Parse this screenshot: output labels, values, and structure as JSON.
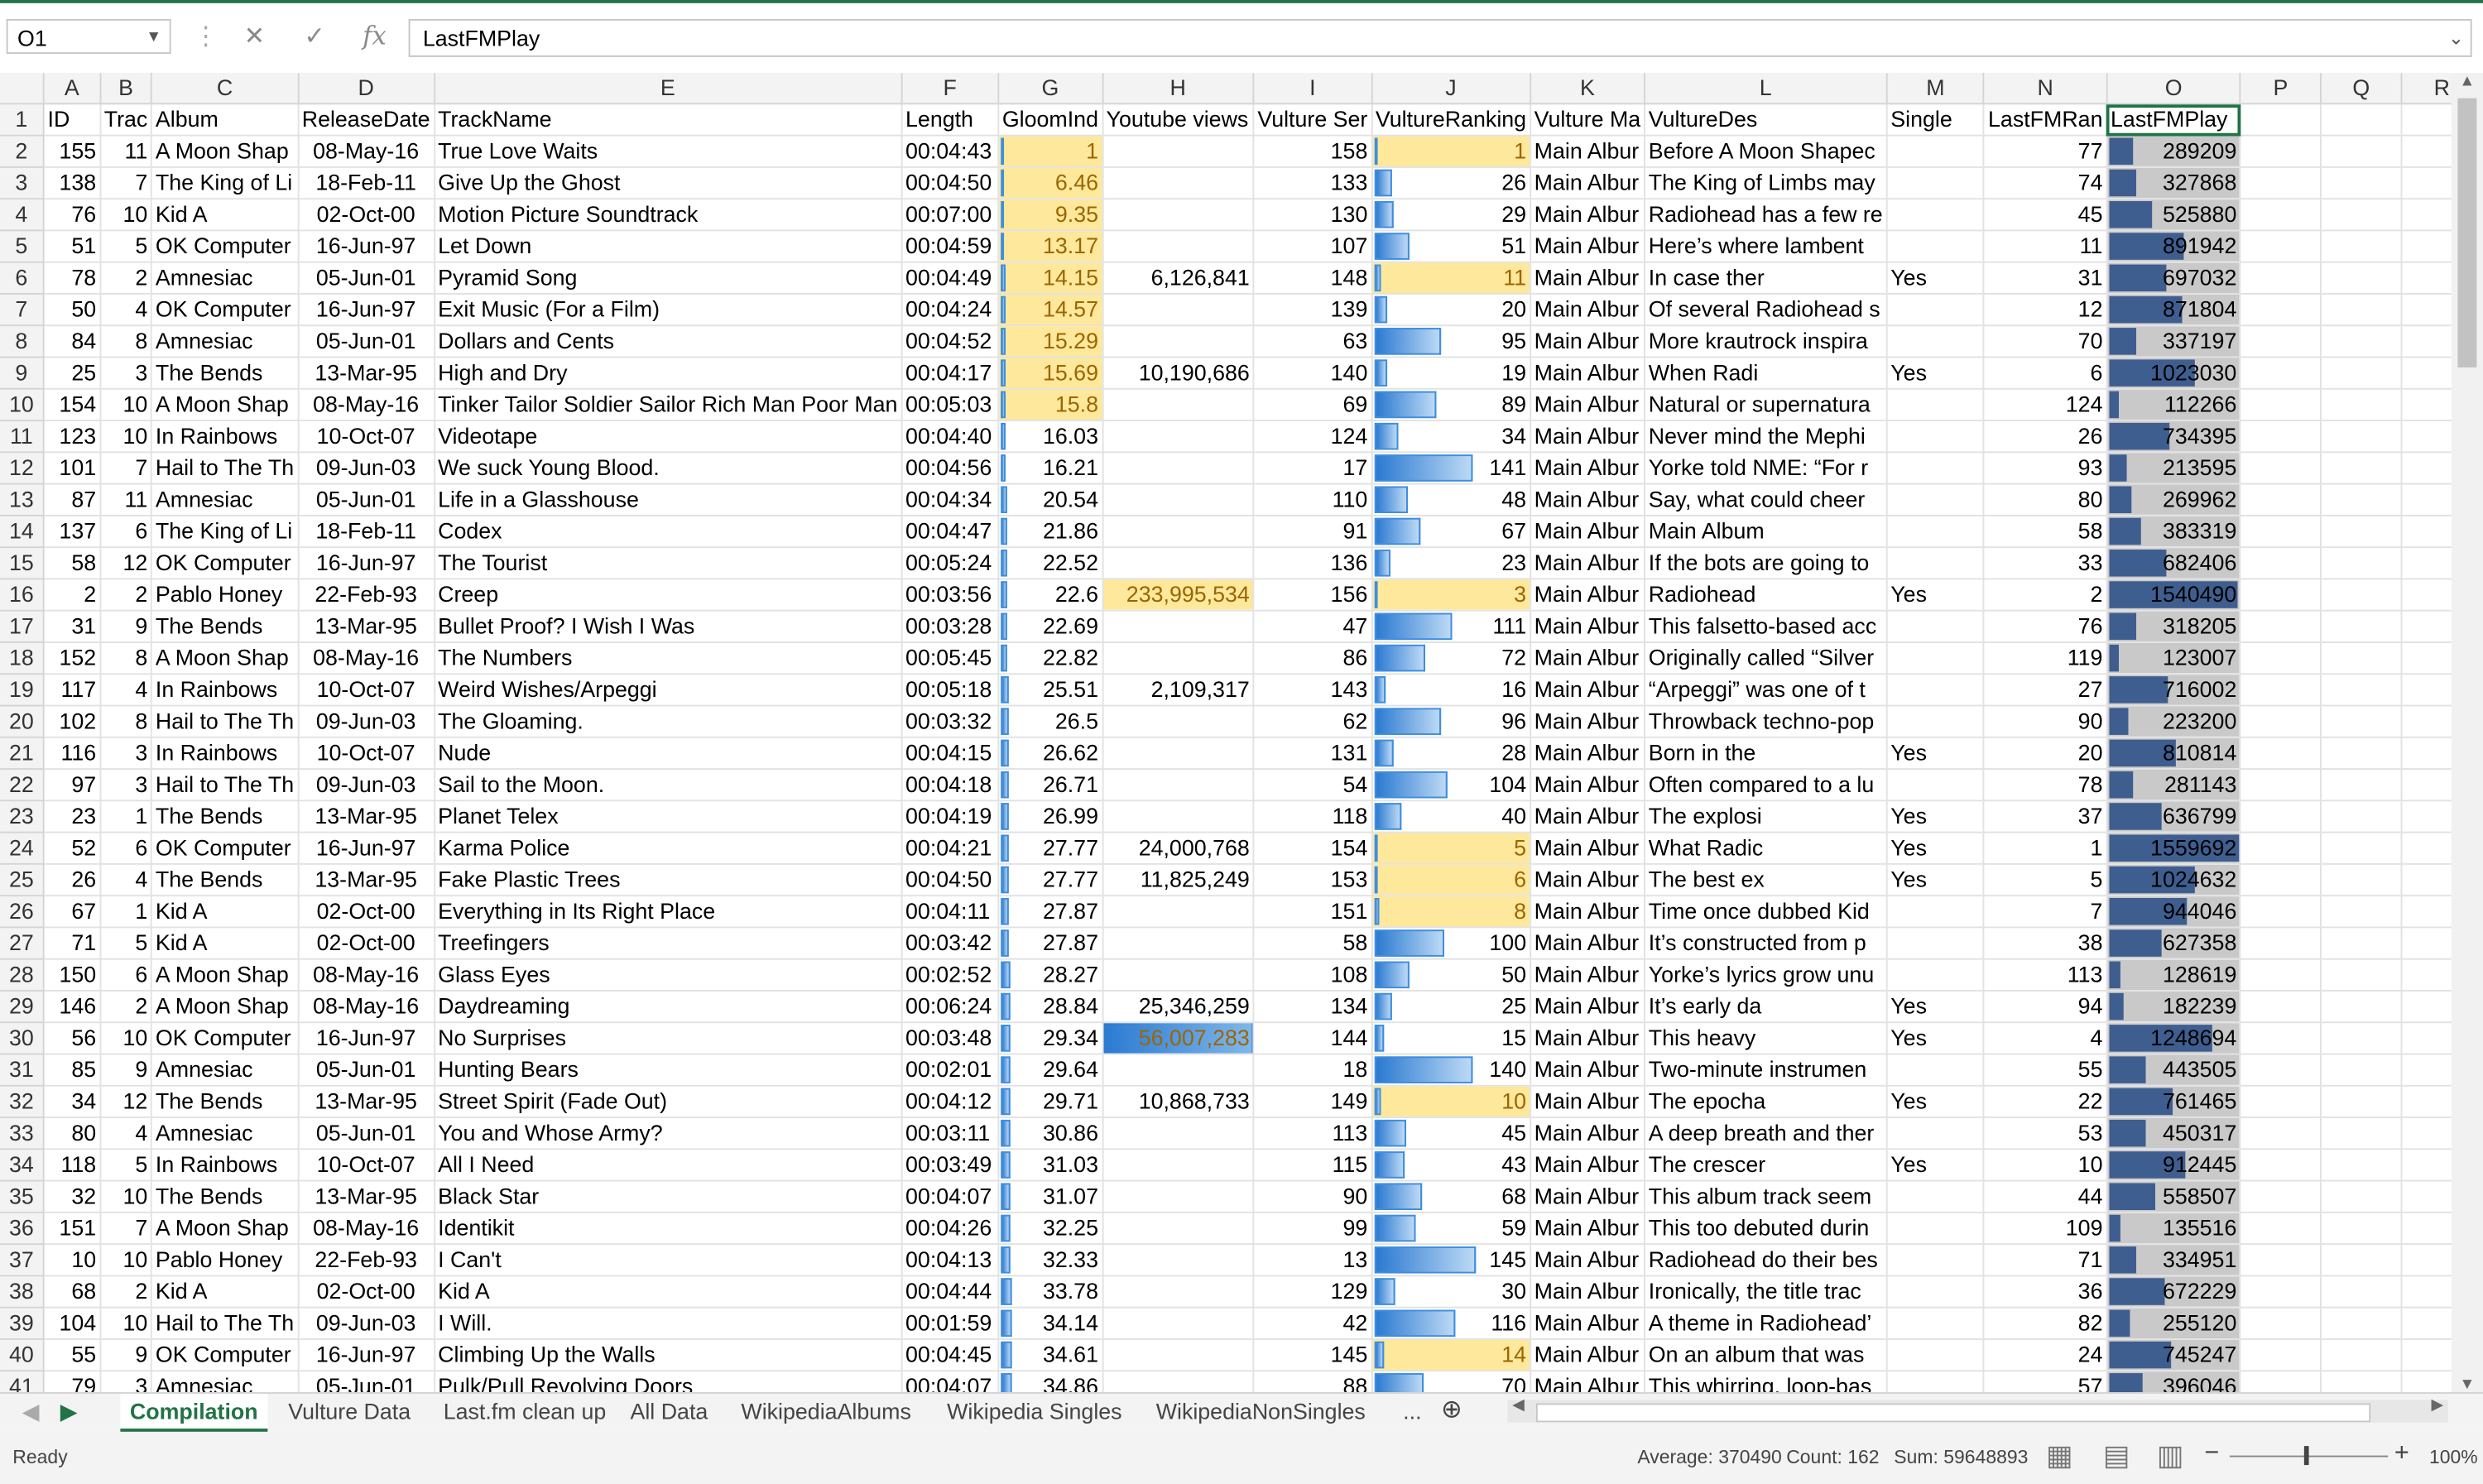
{
  "formula_bar": {
    "name_box": "O1",
    "cancel_icon": "✕",
    "enter_icon": "✓",
    "fx_label": "fx",
    "content": "LastFMPlay"
  },
  "columns": [
    "A",
    "B",
    "C",
    "D",
    "E",
    "F",
    "G",
    "H",
    "I",
    "J",
    "K",
    "L",
    "M",
    "N",
    "O",
    "P",
    "Q",
    "R"
  ],
  "selected_column": "O",
  "header_row": [
    "ID",
    "Trac",
    "Album",
    "ReleaseDate",
    "TrackName",
    "Length",
    "GloomInd",
    "Youtube views",
    "Vulture Ser",
    "VultureRanking",
    "Vulture Ma",
    "VultureDes",
    "Single",
    "LastFMRan",
    "LastFMPlay"
  ],
  "rows": [
    [
      "155",
      "11",
      "A Moon Shap",
      "08-May-16",
      "True Love Waits",
      "00:04:43",
      "1",
      "",
      "158",
      "1",
      "Main Albur",
      "Before A Moon Shapec",
      "",
      "77",
      "289209"
    ],
    [
      "138",
      "7",
      "The King of Li",
      "18-Feb-11",
      "Give Up the Ghost",
      "00:04:50",
      "6.46",
      "",
      "133",
      "26",
      "Main Albur",
      "The King of Limbs may",
      "",
      "74",
      "327868"
    ],
    [
      "76",
      "10",
      "Kid A",
      "02-Oct-00",
      "Motion Picture Soundtrack",
      "00:07:00",
      "9.35",
      "",
      "130",
      "29",
      "Main Albur",
      "Radiohead has a few re",
      "",
      "45",
      "525880"
    ],
    [
      "51",
      "5",
      "OK Computer",
      "16-Jun-97",
      "Let Down",
      "00:04:59",
      "13.17",
      "",
      "107",
      "51",
      "Main Albur",
      "Here’s where lambent",
      "",
      "11",
      "891942"
    ],
    [
      "78",
      "2",
      "Amnesiac",
      "05-Jun-01",
      "Pyramid Song",
      "00:04:49",
      "14.15",
      "6,126,841",
      "148",
      "11",
      "Main Albur",
      "In case ther",
      "Yes",
      "31",
      "697032"
    ],
    [
      "50",
      "4",
      "OK Computer",
      "16-Jun-97",
      "Exit Music (For a Film)",
      "00:04:24",
      "14.57",
      "",
      "139",
      "20",
      "Main Albur",
      "Of several Radiohead s",
      "",
      "12",
      "871804"
    ],
    [
      "84",
      "8",
      "Amnesiac",
      "05-Jun-01",
      "Dollars and Cents",
      "00:04:52",
      "15.29",
      "",
      "63",
      "95",
      "Main Albur",
      "More krautrock inspira",
      "",
      "70",
      "337197"
    ],
    [
      "25",
      "3",
      "The Bends",
      "13-Mar-95",
      "High and Dry",
      "00:04:17",
      "15.69",
      "10,190,686",
      "140",
      "19",
      "Main Albur",
      "When Radi",
      "Yes",
      "6",
      "1023030"
    ],
    [
      "154",
      "10",
      "A Moon Shap",
      "08-May-16",
      "Tinker Tailor Soldier Sailor Rich Man Poor Man",
      "00:05:03",
      "15.8",
      "",
      "69",
      "89",
      "Main Albur",
      "Natural or supernatura",
      "",
      "124",
      "112266"
    ],
    [
      "123",
      "10",
      "In Rainbows",
      "10-Oct-07",
      "Videotape",
      "00:04:40",
      "16.03",
      "",
      "124",
      "34",
      "Main Albur",
      "Never mind the Mephi",
      "",
      "26",
      "734395"
    ],
    [
      "101",
      "7",
      "Hail to The Th",
      "09-Jun-03",
      "We suck Young Blood.",
      "00:04:56",
      "16.21",
      "",
      "17",
      "141",
      "Main Albur",
      "Yorke told NME: “For r",
      "",
      "93",
      "213595"
    ],
    [
      "87",
      "11",
      "Amnesiac",
      "05-Jun-01",
      "Life in a Glasshouse",
      "00:04:34",
      "20.54",
      "",
      "110",
      "48",
      "Main Albur",
      "Say, what could cheer",
      "",
      "80",
      "269962"
    ],
    [
      "137",
      "6",
      "The King of Li",
      "18-Feb-11",
      "Codex",
      "00:04:47",
      "21.86",
      "",
      "91",
      "67",
      "Main Albur",
      "Main Album",
      "",
      "58",
      "383319"
    ],
    [
      "58",
      "12",
      "OK Computer",
      "16-Jun-97",
      "The Tourist",
      "00:05:24",
      "22.52",
      "",
      "136",
      "23",
      "Main Albur",
      "If the bots are going to",
      "",
      "33",
      "682406"
    ],
    [
      "2",
      "2",
      "Pablo Honey",
      "22-Feb-93",
      "Creep",
      "00:03:56",
      "22.6",
      "233,995,534",
      "156",
      "3",
      "Main Albur",
      "Radiohead",
      "Yes",
      "2",
      "1540490"
    ],
    [
      "31",
      "9",
      "The Bends",
      "13-Mar-95",
      "Bullet Proof? I Wish I Was",
      "00:03:28",
      "22.69",
      "",
      "47",
      "111",
      "Main Albur",
      "This falsetto-based acc",
      "",
      "76",
      "318205"
    ],
    [
      "152",
      "8",
      "A Moon Shap",
      "08-May-16",
      "The Numbers",
      "00:05:45",
      "22.82",
      "",
      "86",
      "72",
      "Main Albur",
      "Originally called “Silver",
      "",
      "119",
      "123007"
    ],
    [
      "117",
      "4",
      "In Rainbows",
      "10-Oct-07",
      "Weird Wishes/Arpeggi",
      "00:05:18",
      "25.51",
      "2,109,317",
      "143",
      "16",
      "Main Albur",
      "“Arpeggi” was one of t",
      "",
      "27",
      "716002"
    ],
    [
      "102",
      "8",
      "Hail to The Th",
      "09-Jun-03",
      "The Gloaming.",
      "00:03:32",
      "26.5",
      "",
      "62",
      "96",
      "Main Albur",
      "Throwback techno-pop",
      "",
      "90",
      "223200"
    ],
    [
      "116",
      "3",
      "In Rainbows",
      "10-Oct-07",
      "Nude",
      "00:04:15",
      "26.62",
      "",
      "131",
      "28",
      "Main Albur",
      "Born in the",
      "Yes",
      "20",
      "810814"
    ],
    [
      "97",
      "3",
      "Hail to The Th",
      "09-Jun-03",
      "Sail to the Moon.",
      "00:04:18",
      "26.71",
      "",
      "54",
      "104",
      "Main Albur",
      "Often compared to a lu",
      "",
      "78",
      "281143"
    ],
    [
      "23",
      "1",
      "The Bends",
      "13-Mar-95",
      "Planet Telex",
      "00:04:19",
      "26.99",
      "",
      "118",
      "40",
      "Main Albur",
      "The explosi",
      "Yes",
      "37",
      "636799"
    ],
    [
      "52",
      "6",
      "OK Computer",
      "16-Jun-97",
      "Karma Police",
      "00:04:21",
      "27.77",
      "24,000,768",
      "154",
      "5",
      "Main Albur",
      "What Radic",
      "Yes",
      "1",
      "1559692"
    ],
    [
      "26",
      "4",
      "The Bends",
      "13-Mar-95",
      "Fake Plastic Trees",
      "00:04:50",
      "27.77",
      "11,825,249",
      "153",
      "6",
      "Main Albur",
      "The best ex",
      "Yes",
      "5",
      "1024632"
    ],
    [
      "67",
      "1",
      "Kid A",
      "02-Oct-00",
      "Everything in Its Right Place",
      "00:04:11",
      "27.87",
      "",
      "151",
      "8",
      "Main Albur",
      "Time once dubbed Kid",
      "",
      "7",
      "944046"
    ],
    [
      "71",
      "5",
      "Kid A",
      "02-Oct-00",
      "Treefingers",
      "00:03:42",
      "27.87",
      "",
      "58",
      "100",
      "Main Albur",
      "It’s constructed from p",
      "",
      "38",
      "627358"
    ],
    [
      "150",
      "6",
      "A Moon Shap",
      "08-May-16",
      "Glass Eyes",
      "00:02:52",
      "28.27",
      "",
      "108",
      "50",
      "Main Albur",
      "Yorke’s lyrics grow unu",
      "",
      "113",
      "128619"
    ],
    [
      "146",
      "2",
      "A Moon Shap",
      "08-May-16",
      "Daydreaming",
      "00:06:24",
      "28.84",
      "25,346,259",
      "134",
      "25",
      "Main Albur",
      "It’s early da",
      "Yes",
      "94",
      "182239"
    ],
    [
      "56",
      "10",
      "OK Computer",
      "16-Jun-97",
      "No Surprises",
      "00:03:48",
      "29.34",
      "56,007,283",
      "144",
      "15",
      "Main Albur",
      "This heavy",
      "Yes",
      "4",
      "1248694"
    ],
    [
      "85",
      "9",
      "Amnesiac",
      "05-Jun-01",
      "Hunting Bears",
      "00:02:01",
      "29.64",
      "",
      "18",
      "140",
      "Main Albur",
      "Two-minute instrumen",
      "",
      "55",
      "443505"
    ],
    [
      "34",
      "12",
      "The Bends",
      "13-Mar-95",
      "Street Spirit (Fade Out)",
      "00:04:12",
      "29.71",
      "10,868,733",
      "149",
      "10",
      "Main Albur",
      "The epocha",
      "Yes",
      "22",
      "761465"
    ],
    [
      "80",
      "4",
      "Amnesiac",
      "05-Jun-01",
      "You and Whose Army?",
      "00:03:11",
      "30.86",
      "",
      "113",
      "45",
      "Main Albur",
      "A deep breath and ther",
      "",
      "53",
      "450317"
    ],
    [
      "118",
      "5",
      "In Rainbows",
      "10-Oct-07",
      "All I Need",
      "00:03:49",
      "31.03",
      "",
      "115",
      "43",
      "Main Albur",
      "The crescer",
      "Yes",
      "10",
      "912445"
    ],
    [
      "32",
      "10",
      "The Bends",
      "13-Mar-95",
      "Black Star",
      "00:04:07",
      "31.07",
      "",
      "90",
      "68",
      "Main Albur",
      "This album track seem",
      "",
      "44",
      "558507"
    ],
    [
      "151",
      "7",
      "A Moon Shap",
      "08-May-16",
      "Identikit",
      "00:04:26",
      "32.25",
      "",
      "99",
      "59",
      "Main Albur",
      "This too debuted durin",
      "",
      "109",
      "135516"
    ],
    [
      "10",
      "10",
      "Pablo Honey",
      "22-Feb-93",
      "I Can't",
      "00:04:13",
      "32.33",
      "",
      "13",
      "145",
      "Main Albur",
      "Radiohead do their bes",
      "",
      "71",
      "334951"
    ],
    [
      "68",
      "2",
      "Kid A",
      "02-Oct-00",
      "Kid A",
      "00:04:44",
      "33.78",
      "",
      "129",
      "30",
      "Main Albur",
      "Ironically, the title trac",
      "",
      "36",
      "672229"
    ],
    [
      "104",
      "10",
      "Hail to The Th",
      "09-Jun-03",
      "I Will.",
      "00:01:59",
      "34.14",
      "",
      "42",
      "116",
      "Main Albur",
      "A theme in Radiohead’",
      "",
      "82",
      "255120"
    ],
    [
      "55",
      "9",
      "OK Computer",
      "16-Jun-97",
      "Climbing Up the Walls",
      "00:04:45",
      "34.61",
      "",
      "145",
      "14",
      "Main Albur",
      "On an album that was",
      "",
      "24",
      "745247"
    ],
    [
      "79",
      "3",
      "Amnesiac",
      "05-Jun-01",
      "Pulk/Pull Revolving Doors",
      "00:04:07",
      "34.86",
      "",
      "88",
      "70",
      "Main Albur",
      "This whirring, loop-bas",
      "",
      "57",
      "396046"
    ]
  ],
  "sheet_tabs": [
    "Compilation",
    "Vulture Data",
    "Last.fm clean up",
    "All Data",
    "WikipediaAlbums",
    "Wikipedia Singles",
    "WikipediaNonSingles"
  ],
  "active_tab": "Compilation",
  "tabs_more": "...",
  "status": {
    "ready": "Ready",
    "average": "Average: 370490",
    "count": "Count: 162",
    "sum": "Sum: 59648893",
    "zoom": "100%"
  },
  "colors": {
    "accent": "#217346",
    "highlight_yellow": "#fde89b",
    "databar_blue": "#2b7ad1",
    "databar_dark": "#3f5e90"
  }
}
